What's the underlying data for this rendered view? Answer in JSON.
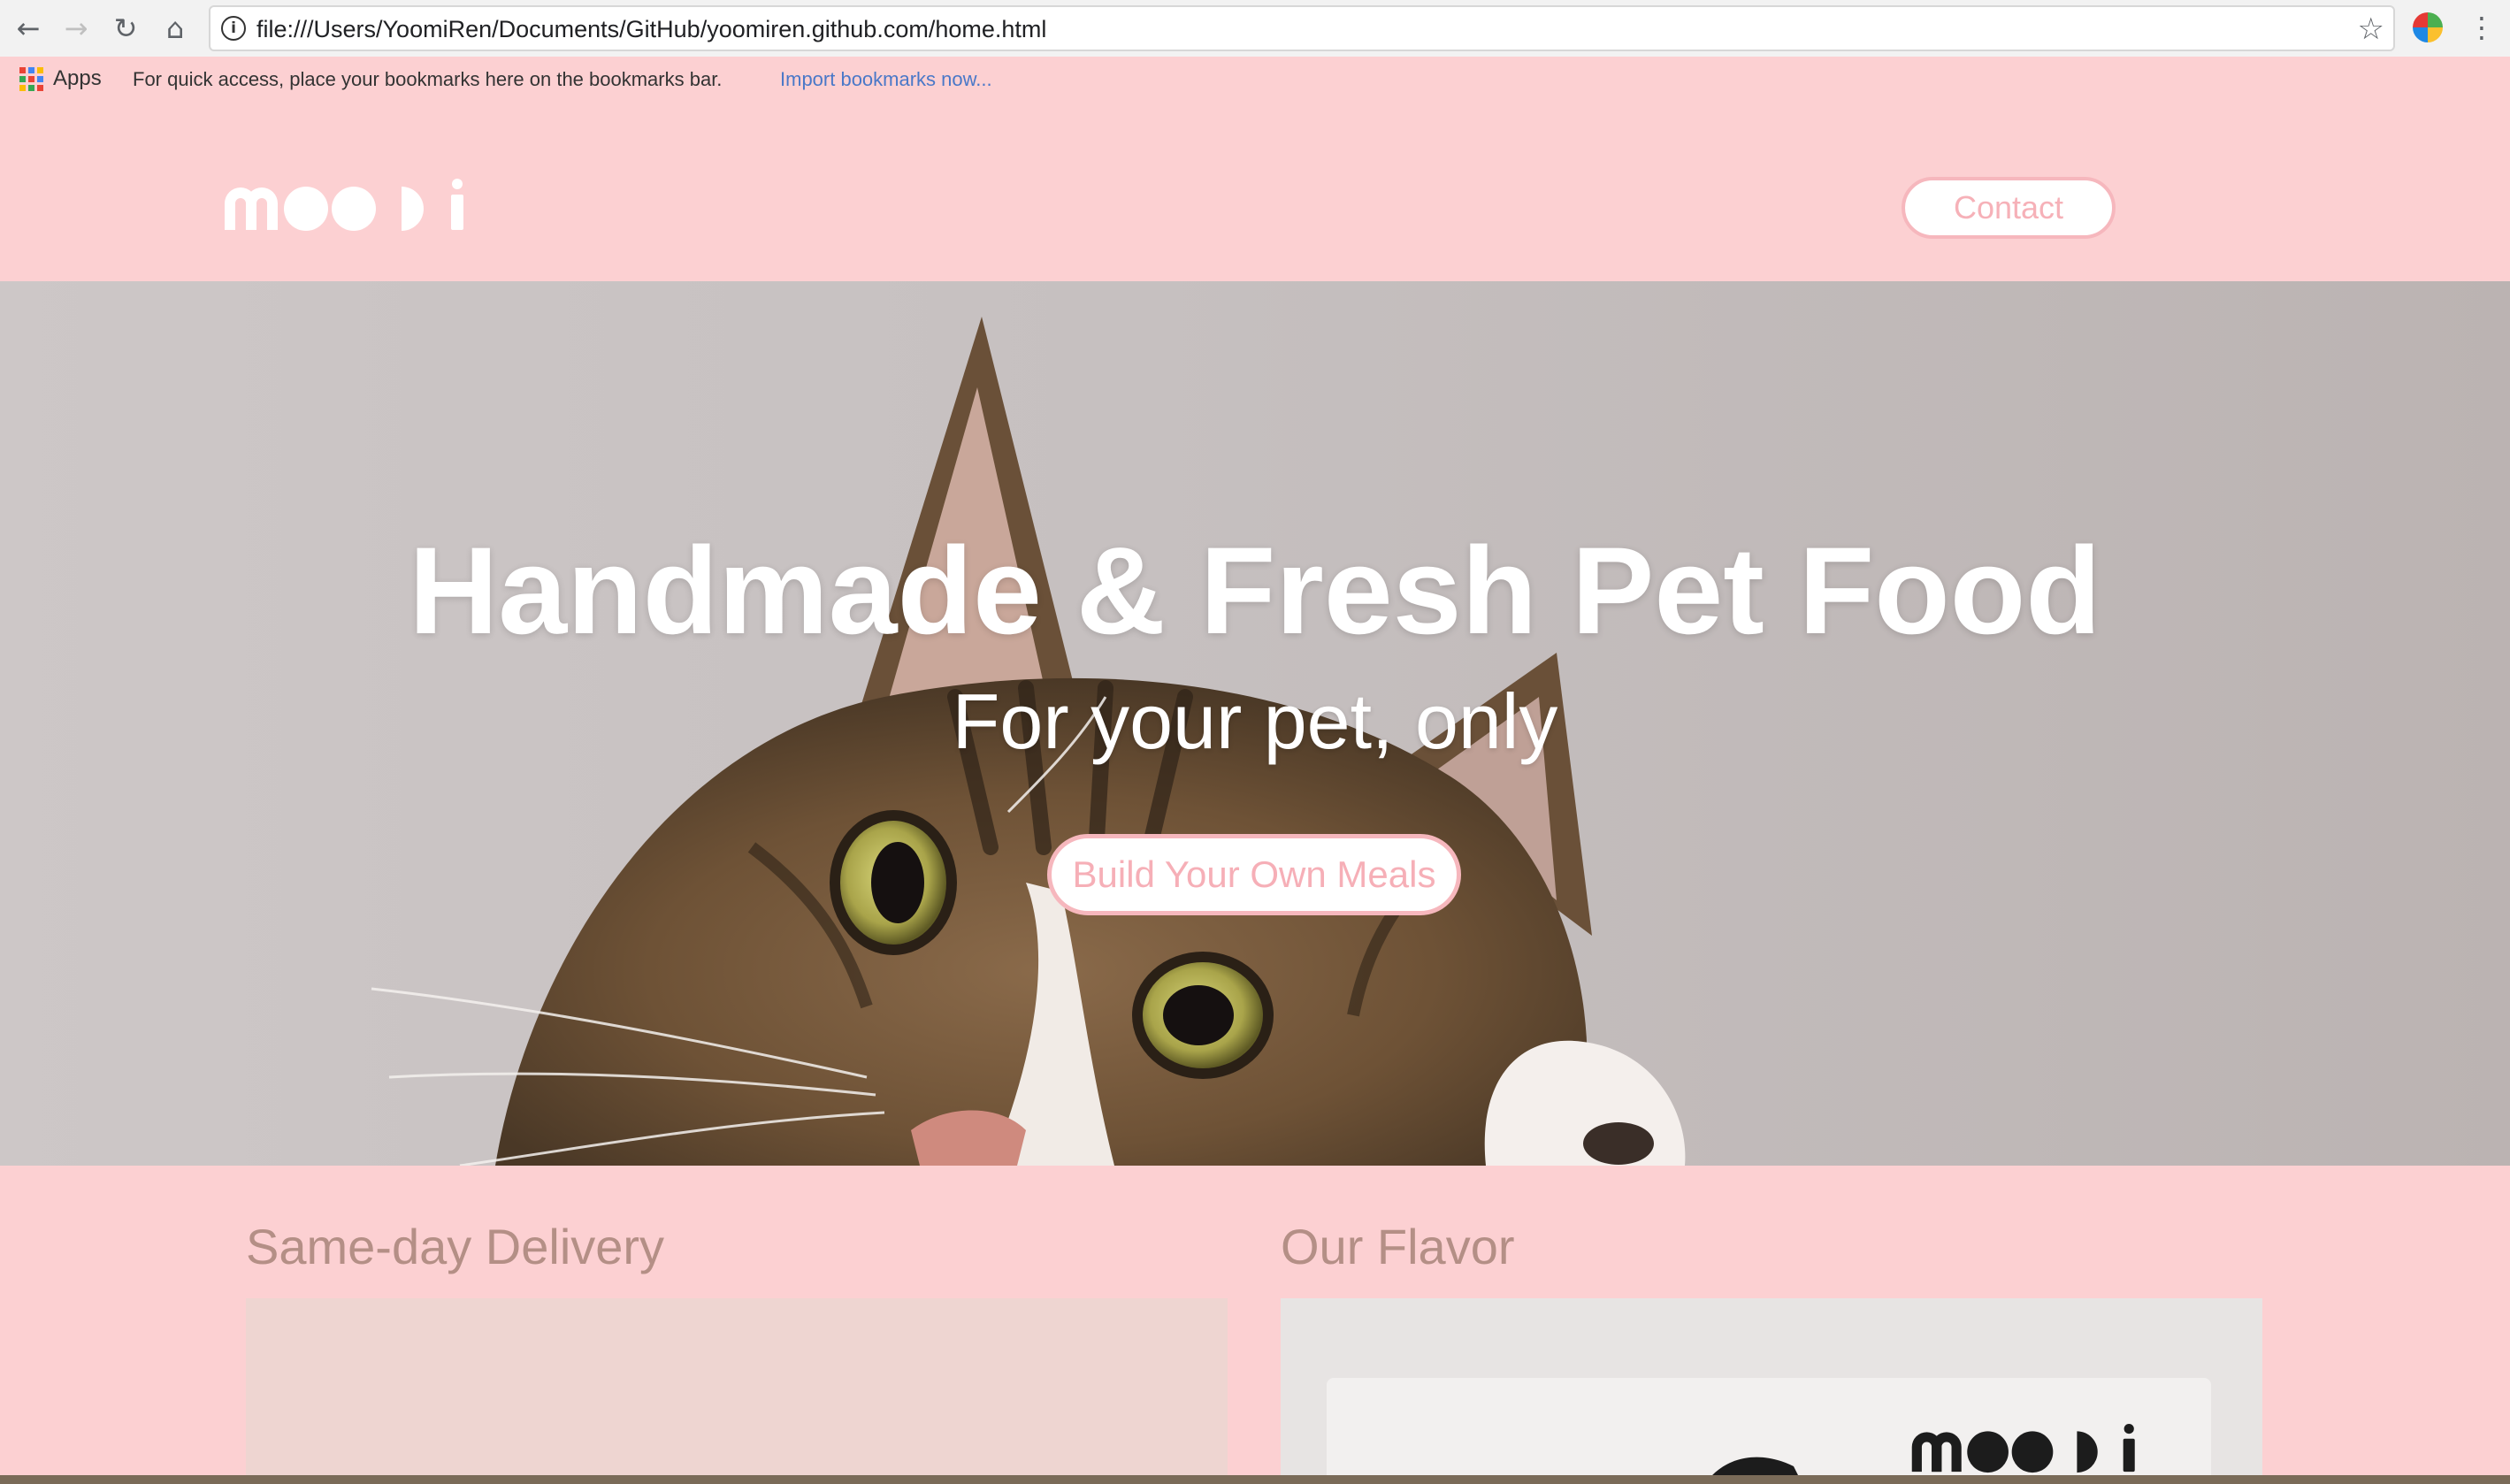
{
  "browser": {
    "url": "file:///Users/YoomiRen/Documents/GitHub/yoomiren.github.com/home.html",
    "nav_icons": [
      "back-arrow-icon",
      "forward-arrow-icon",
      "reload-icon",
      "home-icon"
    ],
    "bookmarks_bar": {
      "apps_label": "Apps",
      "message": "For quick access, place your bookmarks here on the bookmarks bar.",
      "import_link": "Import bookmarks now..."
    }
  },
  "site": {
    "logo_text": "mooоi",
    "contact_label": "Contact",
    "hero": {
      "title": "Handmade & Fresh Pet Food",
      "subtitle": "For your pet, only",
      "cta_label": "Build Your Own Meals"
    },
    "sections": [
      {
        "title": "Same-day Delivery"
      },
      {
        "title": "Our Flavor"
      }
    ]
  },
  "colors": {
    "page_background": "#fcd0d2",
    "accent_pink": "#f6b7bd",
    "section_title": "#b48f86",
    "white": "#ffffff"
  }
}
